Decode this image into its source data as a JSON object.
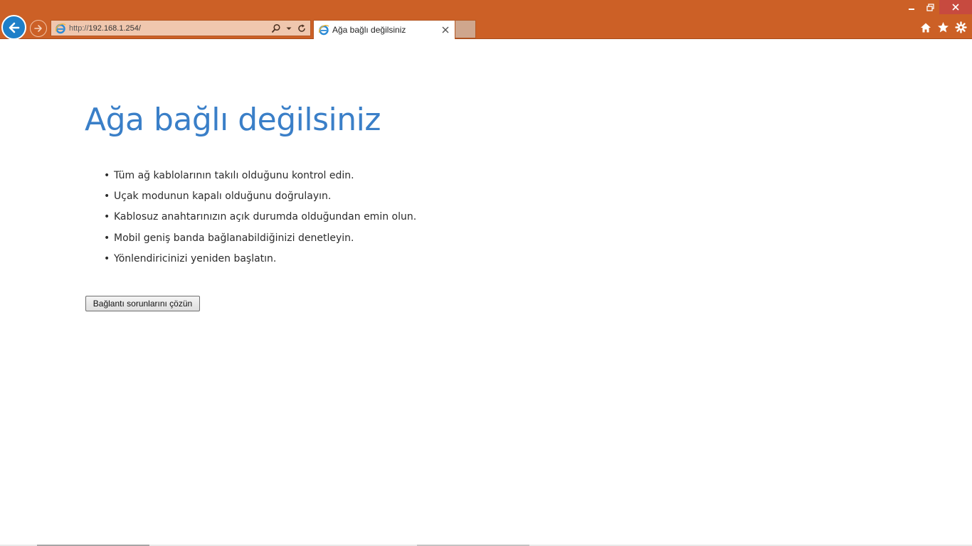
{
  "browser": {
    "address": {
      "scheme": "http://",
      "host": "192.168.1.254/"
    },
    "tab": {
      "title": "Ağa bağlı değilsiniz"
    },
    "icons": {
      "back": "back-arrow-icon",
      "forward": "forward-arrow-icon",
      "site": "ie-logo-icon",
      "search": "search-icon",
      "dropdown": "chevron-down-icon",
      "refresh": "refresh-icon",
      "close_tab": "close-icon",
      "home": "home-icon",
      "favorites": "star-icon",
      "tools": "gear-icon",
      "minimize": "minimize-icon",
      "restore": "restore-icon",
      "close_window": "close-icon"
    },
    "colors": {
      "frame": "#cc6026",
      "back_button": "#1e7fc8",
      "close_button": "#c74a3f"
    }
  },
  "page": {
    "title": "Ağa bağlı değilsiniz",
    "title_color": "#3a7fc8",
    "tips": [
      "Tüm ağ kablolarının takılı olduğunu kontrol edin.",
      "Uçak modunun kapalı olduğunu doğrulayın.",
      "Kablosuz anahtarınızın açık durumda olduğundan emin olun.",
      "Mobil geniş banda bağlanabildiğinizi denetleyin.",
      "Yönlendiricinizi yeniden başlatın."
    ],
    "fix_button": "Bağlantı sorunlarını çözün"
  }
}
